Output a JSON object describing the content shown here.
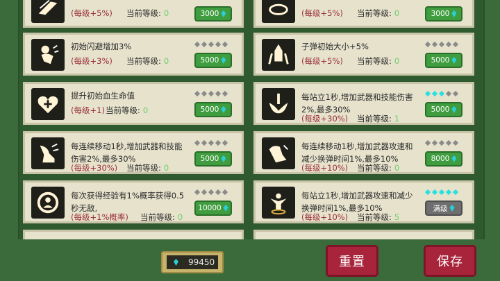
{
  "cards": [
    {
      "bonus": "(每级+5%)",
      "level_label": "当前等级:",
      "level": "0",
      "cost": "3000",
      "dots": 0
    },
    {
      "bonus": "(每级+5%)",
      "level_label": "当前等级:",
      "level": "0",
      "cost": "3000",
      "dots": 0
    },
    {
      "desc": "初始闪避增加3%",
      "bonus": "(每级+3%)",
      "level_label": "当前等级:",
      "level": "0",
      "cost": "5000",
      "dots": 0
    },
    {
      "desc": "子弹初始大小+5%",
      "bonus": "(每级+5%)",
      "level_label": "当前等级:",
      "level": "0",
      "cost": "5000",
      "dots": 0
    },
    {
      "desc": "提升初始血生命值",
      "bonus": "(每级+1)",
      "level_label": "当前等级:",
      "level": "0",
      "cost": "5000",
      "dots": 0
    },
    {
      "desc": "每站立1秒,增加武器和技能伤害2%,最多30%",
      "bonus": "(每级+30%)",
      "level_label": "当前等级:",
      "level": "1",
      "cost": "5000",
      "dots": 3
    },
    {
      "desc": "每连续移动1秒,增加武器和技能伤害2%,最多30%",
      "bonus": "(每级+30%)",
      "level_label": "当前等级:",
      "level": "0",
      "cost": "5000",
      "dots": 0
    },
    {
      "desc": "每连续移动1秒,增加武器攻速和减少换弹时间1%,最多10%",
      "bonus": "(每级+10%)",
      "level_label": "当前等级:",
      "level": "0",
      "cost": "8000",
      "dots": 0
    },
    {
      "desc": "每次获得经验有1%概率获得0.5秒无敌,",
      "bonus": "(每级+1%概率)",
      "level_label": "当前等级:",
      "level": "0",
      "cost": "10000",
      "dots": 0
    },
    {
      "desc": "每站立1秒,增加武器攻速和减少换弹时间1%,最多10%",
      "bonus": "(每级+10%)",
      "level_label": "当前等级:",
      "level": "5",
      "cost": "满级",
      "dots": 5
    }
  ],
  "currency": {
    "amount": "99450"
  },
  "buttons": {
    "reset": "重置",
    "save": "保存"
  },
  "colors": {
    "background": "#3b6b3b",
    "card": "#e6e2cc",
    "bonus": "#9a2f3a",
    "buy_button": "#3f9d3f",
    "max_button": "#6e6e6e",
    "gem": "#2ad0d8",
    "action_button": "#a8243a"
  }
}
